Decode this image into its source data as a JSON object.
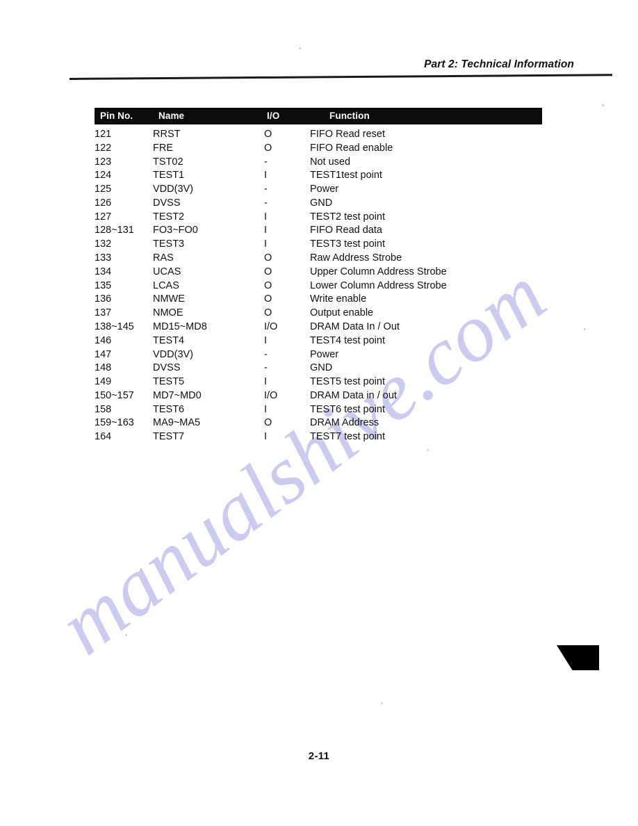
{
  "document": {
    "running_head": "Part 2: Technical Information",
    "page_number": "2-11",
    "watermark": "manualshive.com"
  },
  "table": {
    "headers": {
      "pin": "Pin No.",
      "name": "Name",
      "io": "I/O",
      "function": "Function"
    },
    "rows": [
      {
        "pin": "121",
        "name": "RRST",
        "io": "O",
        "function": "FIFO Read reset"
      },
      {
        "pin": "122",
        "name": "FRE",
        "io": "O",
        "function": "FIFO Read enable"
      },
      {
        "pin": "123",
        "name": "TST02",
        "io": "-",
        "function": "Not used"
      },
      {
        "pin": "124",
        "name": "TEST1",
        "io": "I",
        "function": "TEST1test point"
      },
      {
        "pin": "125",
        "name": "VDD(3V)",
        "io": "-",
        "function": "Power"
      },
      {
        "pin": "126",
        "name": "DVSS",
        "io": "-",
        "function": "GND"
      },
      {
        "pin": "127",
        "name": "TEST2",
        "io": "I",
        "function": "TEST2 test point"
      },
      {
        "pin": "128~131",
        "name": "FO3~FO0",
        "io": "I",
        "function": "FIFO Read data"
      },
      {
        "pin": "132",
        "name": "TEST3",
        "io": "I",
        "function": "TEST3 test point"
      },
      {
        "pin": "133",
        "name": "RAS",
        "io": "O",
        "function": "Raw Address Strobe"
      },
      {
        "pin": "134",
        "name": "UCAS",
        "io": "O",
        "function": "Upper Column Address Strobe"
      },
      {
        "pin": "135",
        "name": "LCAS",
        "io": "O",
        "function": "Lower Column Address Strobe"
      },
      {
        "pin": "136",
        "name": "NMWE",
        "io": "O",
        "function": "Write enable"
      },
      {
        "pin": "137",
        "name": "NMOE",
        "io": "O",
        "function": "Output enable"
      },
      {
        "pin": "138~145",
        "name": "MD15~MD8",
        "io": "I/O",
        "function": "DRAM Data In / Out"
      },
      {
        "pin": "146",
        "name": "TEST4",
        "io": "I",
        "function": "TEST4 test point"
      },
      {
        "pin": "147",
        "name": "VDD(3V)",
        "io": "-",
        "function": "Power"
      },
      {
        "pin": "148",
        "name": "DVSS",
        "io": "-",
        "function": "GND"
      },
      {
        "pin": "149",
        "name": "TEST5",
        "io": "I",
        "function": "TEST5 test point"
      },
      {
        "pin": "150~157",
        "name": "MD7~MD0",
        "io": "I/O",
        "function": "DRAM Data in / out"
      },
      {
        "pin": "158",
        "name": "TEST6",
        "io": "I",
        "function": "TEST6 test point"
      },
      {
        "pin": "159~163",
        "name": "MA9~MA5",
        "io": "O",
        "function": "DRAM Address"
      },
      {
        "pin": "164",
        "name": "TEST7",
        "io": "I",
        "function": "TEST7 test point"
      }
    ]
  },
  "colors": {
    "header_band": "#0b0b0b",
    "text": "#111111",
    "watermark": "#c9c9ef"
  }
}
